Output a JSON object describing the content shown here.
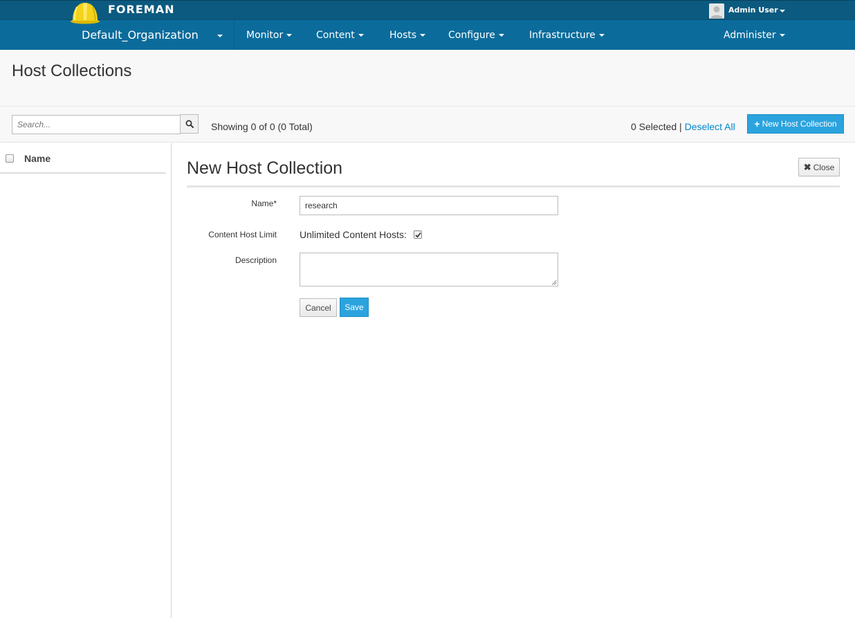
{
  "brand": {
    "name": "FOREMAN"
  },
  "user": {
    "name": "Admin User"
  },
  "nav": {
    "organization": "Default_Organization",
    "items": [
      {
        "label": "Monitor"
      },
      {
        "label": "Content"
      },
      {
        "label": "Hosts"
      },
      {
        "label": "Configure"
      },
      {
        "label": "Infrastructure"
      },
      {
        "label": "Administer"
      }
    ]
  },
  "page": {
    "title": "Host Collections"
  },
  "toolbar": {
    "search_placeholder": "Search...",
    "showing": "Showing 0 of 0 (0 Total)",
    "selected": "0 Selected |",
    "deselect_label": "Deselect All",
    "new_label": "New Host Collection"
  },
  "list": {
    "column_name": "Name"
  },
  "form": {
    "title": "New Host Collection",
    "close_label": "Close",
    "name_label": "Name*",
    "name_value": "research",
    "limit_label": "Content Host Limit",
    "unlimited_label": "Unlimited Content Hosts:",
    "unlimited_checked": true,
    "description_label": "Description",
    "description_value": "",
    "cancel_label": "Cancel",
    "save_label": "Save"
  },
  "colors": {
    "topbar": "#0c5a7f",
    "navbar": "#0b6c9c",
    "primary_button": "#2ba3de",
    "link": "#0088ce"
  },
  "icons": {
    "logo": "helmet-logo-icon",
    "avatar": "user-avatar-icon",
    "search": "search-icon",
    "plus": "plus-icon",
    "close": "close-icon",
    "check": "checkmark-icon"
  }
}
